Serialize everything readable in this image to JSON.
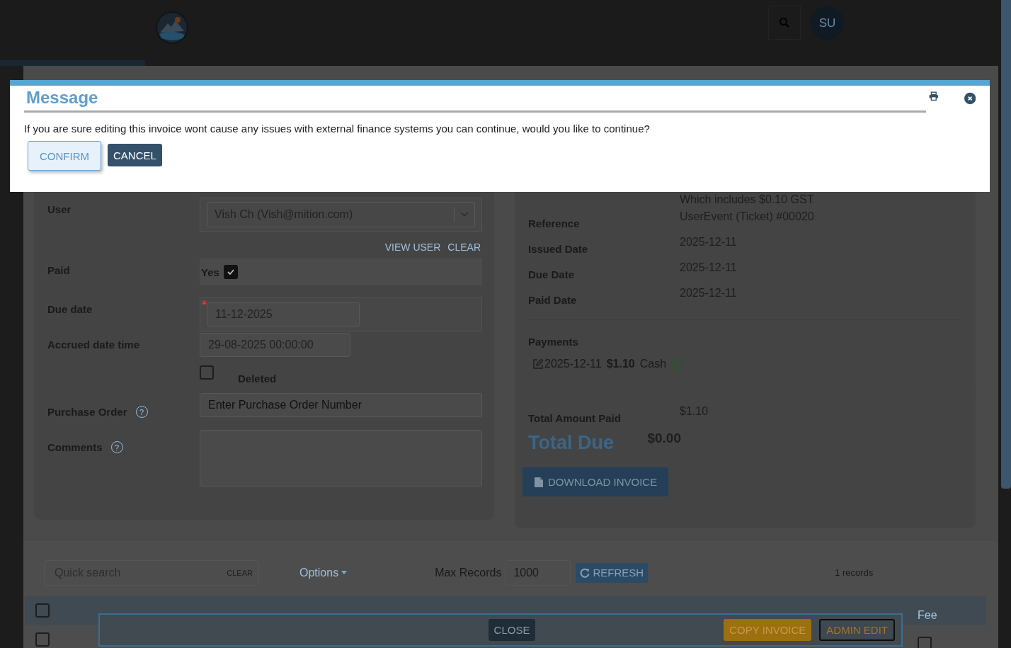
{
  "header": {
    "avatar_initials": "SU"
  },
  "dialog": {
    "title": "Message",
    "message": "If you are sure editing this invoice wont cause any issues with external finance systems you can continue, would you like to continue?",
    "buttons": [
      {
        "label": "CONFIRM",
        "kind": "outline"
      },
      {
        "label": "CANCEL",
        "kind": "solid"
      }
    ]
  },
  "form": {
    "user": {
      "label": "User",
      "value": "Vish Ch (Vish@mition.com)"
    },
    "user_links": [
      "VIEW USER",
      "CLEAR"
    ],
    "paid": {
      "label": "Paid",
      "option": "Yes",
      "checked": true
    },
    "due_date": {
      "label": "Due date",
      "value": "11-12-2025",
      "required": true
    },
    "accrued": {
      "label": "Accrued date time",
      "value": "29-08-2025 00:00:00"
    },
    "deleted": {
      "label": "Deleted",
      "checked": false
    },
    "purchase_order": {
      "label": "Purchase Order",
      "help": "?",
      "placeholder": "Enter Purchase Order Number"
    },
    "comments": {
      "label": "Comments",
      "help": "?"
    }
  },
  "summary": {
    "gst_note": "Which includes $0.10 GST",
    "details": [
      {
        "label": "Reference",
        "value": "UserEvent (Ticket) #00020"
      },
      {
        "label": "Issued Date",
        "value": "2025-12-11"
      },
      {
        "label": "Due Date",
        "value": "2025-12-11"
      },
      {
        "label": "Paid Date",
        "value": "2025-12-11"
      }
    ],
    "payments_title": "Payments",
    "payments": [
      {
        "date": "2025-12-11",
        "amount": "$1.10",
        "method": "Cash",
        "confirmed": true
      }
    ],
    "total_paid": {
      "label": "Total Amount Paid",
      "value": "$1.10"
    },
    "total_due": {
      "label": "Total Due",
      "value": "$0.00"
    },
    "download_button": "DOWNLOAD INVOICE"
  },
  "records": {
    "search_placeholder": "Quick search",
    "clear_label": "CLEAR",
    "options_label": "Options",
    "max_records_label": "Max Records",
    "max_records_value": "1000",
    "refresh_label": "REFRESH",
    "count": "1 records",
    "header_checked": false,
    "columns": [
      {
        "label": "Fee"
      }
    ],
    "rows": [
      {
        "selected": false,
        "fee": false
      }
    ]
  },
  "footer_buttons": [
    {
      "label": "CLOSE",
      "kind": "close"
    },
    {
      "label": "COPY INVOICE",
      "kind": "copy"
    },
    {
      "label": "ADMIN EDIT",
      "kind": "admin"
    }
  ]
}
